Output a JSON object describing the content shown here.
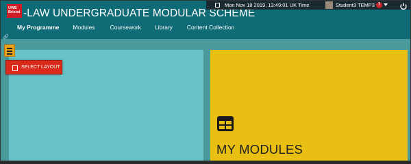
{
  "header": {
    "logo_text": "UWE Bristol",
    "title": "-LAW UNDERGRADUATE MODULAR SCHEME",
    "datetime": "Mon Nov 18 2019, 13:49:01 UK Time",
    "user_name": "Student3 TEMP3",
    "notification_count": "7"
  },
  "nav": {
    "tabs": [
      {
        "label": "My Programme"
      },
      {
        "label": "Modules"
      },
      {
        "label": "Coursework"
      },
      {
        "label": "Library"
      },
      {
        "label": "Content Collection"
      }
    ]
  },
  "layout_menu": {
    "select_label": "SELECT LAYOUT"
  },
  "modules_panel": {
    "title": "MY MODULES"
  },
  "colors": {
    "header_bg": "#0f6b75",
    "infobar_bg": "#1b2a30",
    "main_bg": "#4a9a9c",
    "left_panel": "#67c3c7",
    "right_panel": "#e8bf12",
    "select_layout_bg": "#d92a1a",
    "hamburger_bg": "#e8a21a",
    "badge": "#c8202a"
  },
  "icons": [
    "clock-icon",
    "avatar",
    "caret-icon",
    "power-icon",
    "link-icon",
    "hamburger-menu-icon",
    "layout-icon",
    "modules-grid-icon"
  ]
}
